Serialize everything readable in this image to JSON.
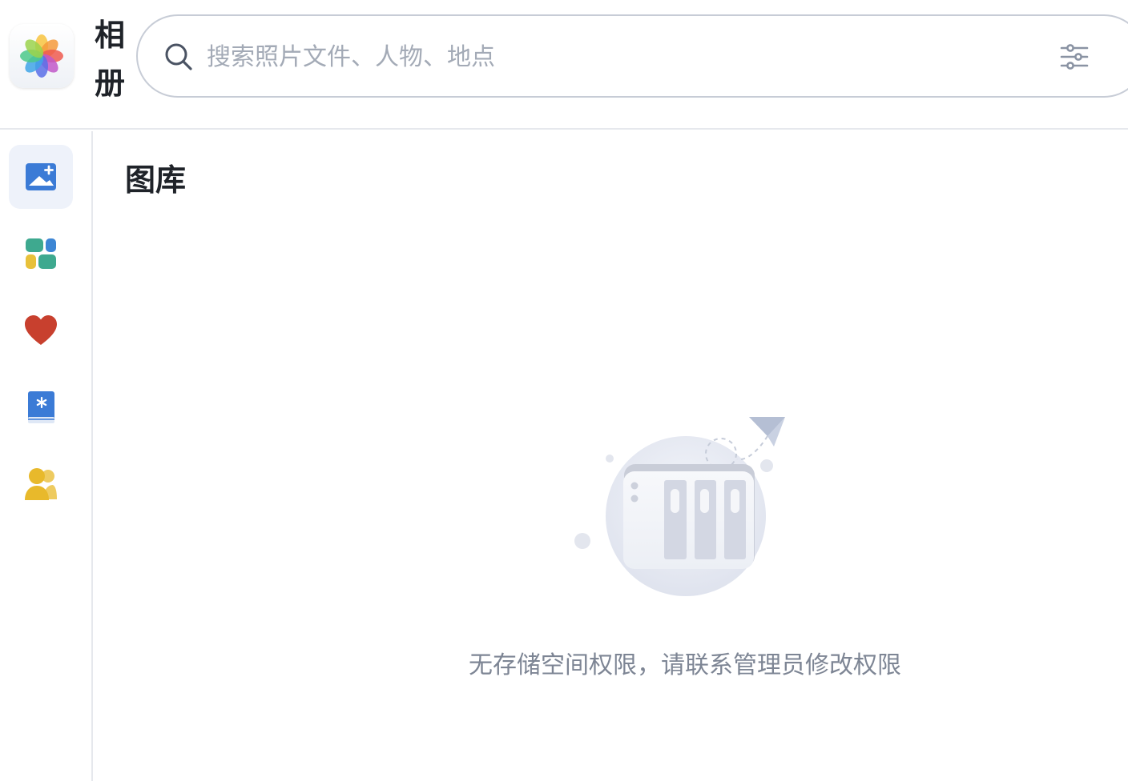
{
  "app": {
    "title": "相册",
    "logo_icon": "photos-flower-icon"
  },
  "search": {
    "placeholder": "搜索照片文件、人物、地点",
    "value": "",
    "search_icon": "search-icon",
    "filter_icon": "filter-sliders-icon"
  },
  "sidebar": {
    "items": [
      {
        "id": "library",
        "icon": "image-add-icon",
        "active": true
      },
      {
        "id": "albums",
        "icon": "albums-grid-icon",
        "active": false
      },
      {
        "id": "favorites",
        "icon": "heart-icon",
        "active": false
      },
      {
        "id": "shared-album",
        "icon": "book-icon",
        "active": false
      },
      {
        "id": "people",
        "icon": "people-icon",
        "active": false
      }
    ]
  },
  "main": {
    "title": "图库",
    "empty_message": "无存储空间权限，请联系管理员修改权限",
    "empty_icon": "nas-storage-illustration"
  },
  "colors": {
    "accent": "#3b7bd6",
    "border": "#e6e8ed",
    "placeholder": "#a3aab6",
    "muted_text": "#7d8594",
    "active_bg": "#eef2fa",
    "heart": "#c8402e",
    "people": "#e8b92b"
  }
}
